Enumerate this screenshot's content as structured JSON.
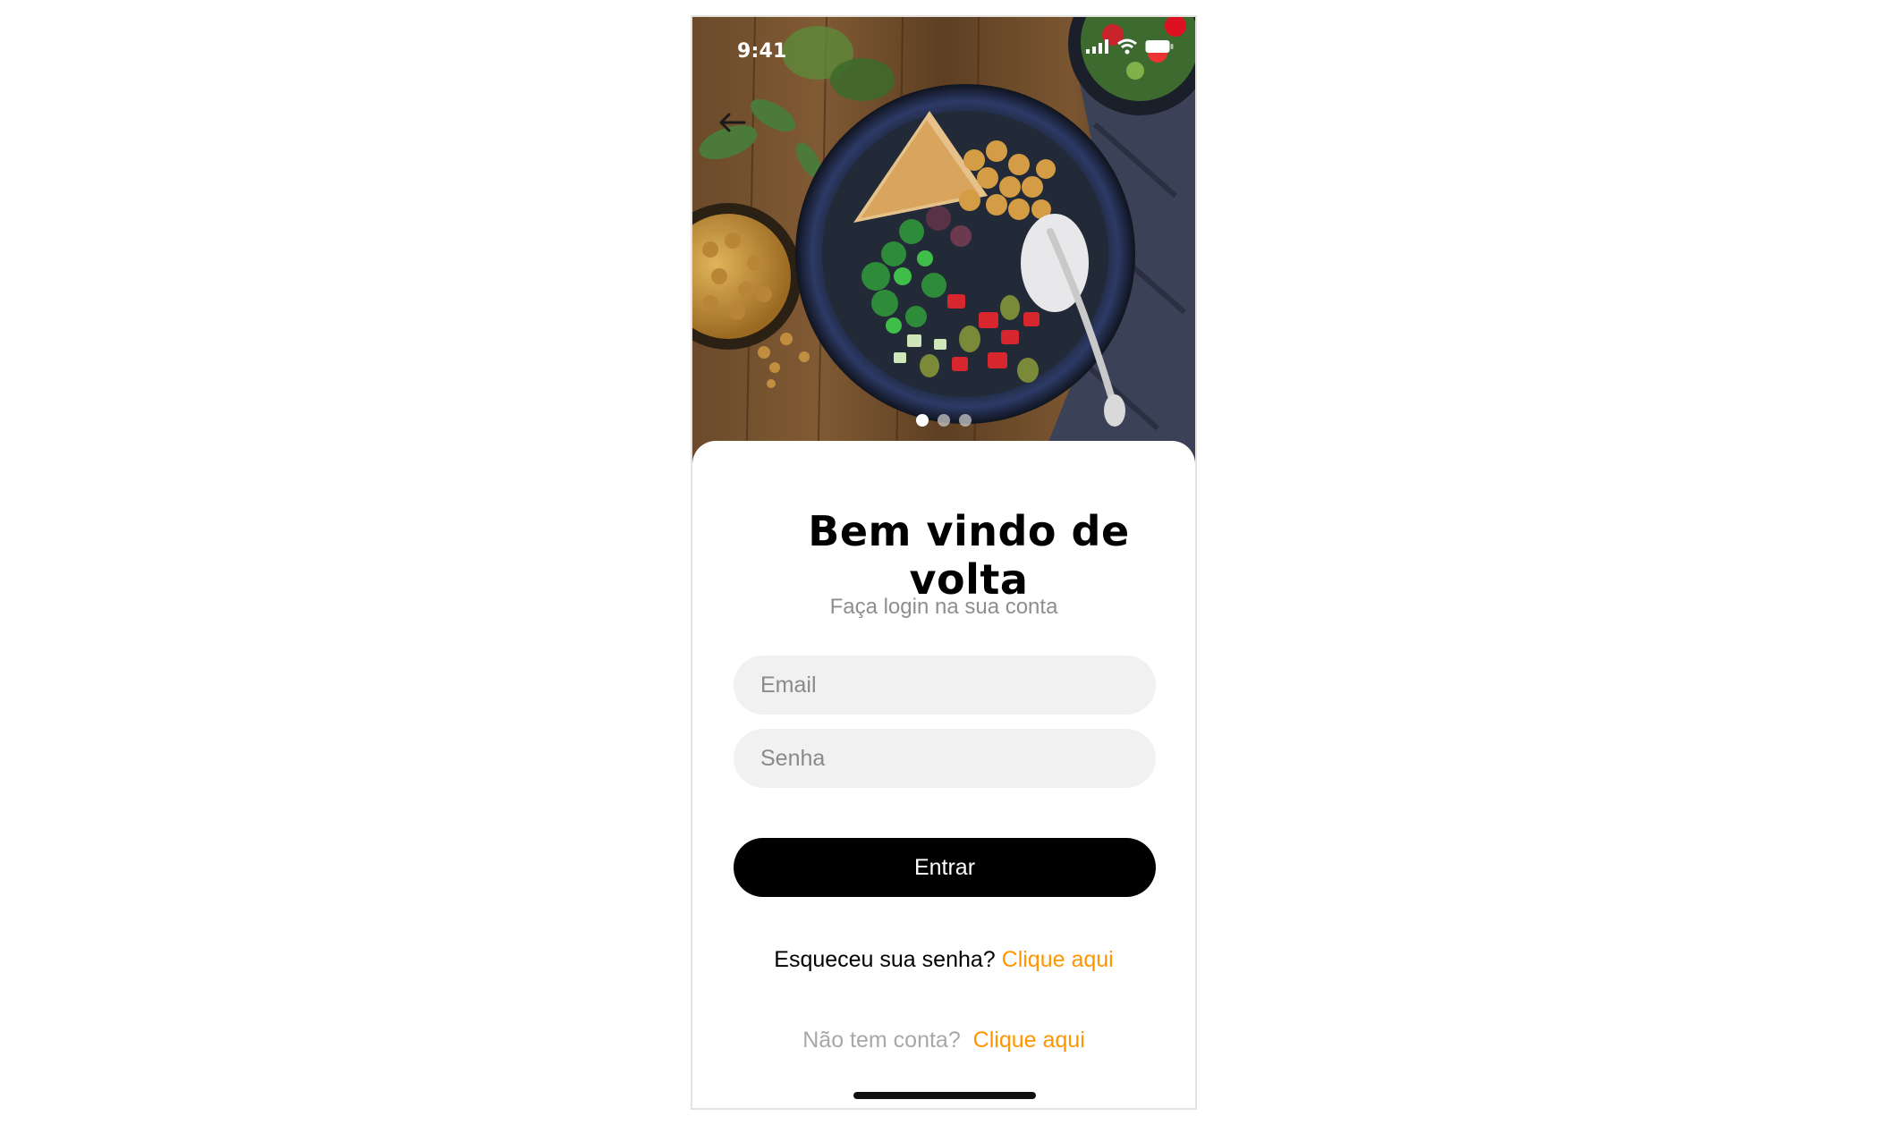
{
  "status_bar": {
    "time": "9:41"
  },
  "header": {
    "back_icon": "arrow-left-icon"
  },
  "carousel": {
    "dot_count": 3,
    "active_index": 0
  },
  "login": {
    "title": "Bem vindo de volta",
    "subtitle": "Faça login na sua conta",
    "email_placeholder": "Email",
    "password_placeholder": "Senha",
    "submit_label": "Entrar",
    "forgot_text": "Esqueceu sua senha?",
    "forgot_link": "Clique aqui",
    "signup_text": "Não tem conta?",
    "signup_link": "Clique aqui"
  },
  "colors": {
    "accent": "#ff9500",
    "button": "#000000",
    "input_bg": "#f1f1f1",
    "muted_text": "#8e8e8e"
  }
}
